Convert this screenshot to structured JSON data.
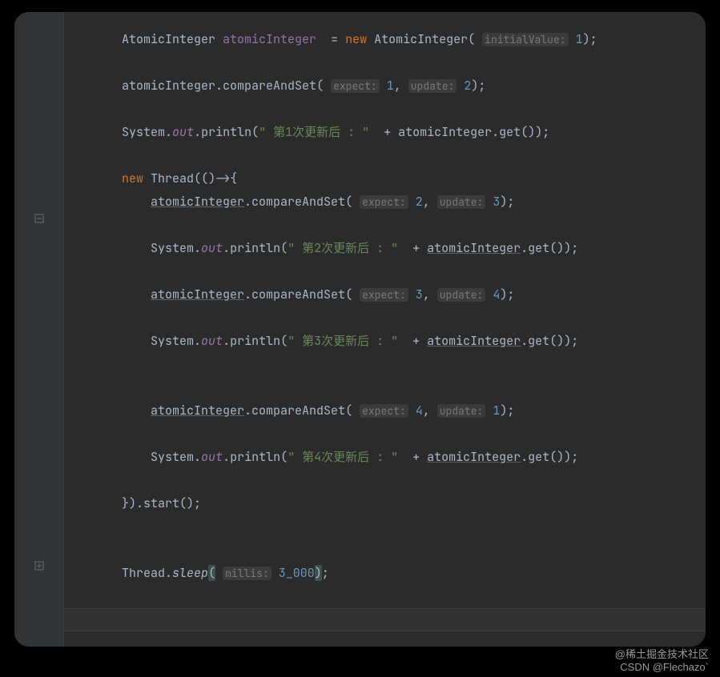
{
  "watermark": {
    "line1": "@稀土掘金技术社区",
    "line2": "CSDN @Flechazo`"
  },
  "code": {
    "indent1": "        ",
    "indent2": "            ",
    "decl": {
      "type": "AtomicInteger",
      "name": "atomicInteger",
      "eq": "  = ",
      "kw_new": "new",
      "ctor": "AtomicInteger",
      "hint": "initialValue:",
      "val": "1"
    },
    "cas1": {
      "obj": "atomicInteger",
      "method": "compareAndSet",
      "h1": "expect:",
      "v1": "1",
      "h2": "update:",
      "v2": "2"
    },
    "p1": {
      "cls": "System",
      "out": "out",
      "m": "println",
      "s": "\" 第1次更新后 : \"",
      "plus": "  + ",
      "obj": "atomicInteger",
      "g": "get"
    },
    "thr": {
      "kw_new": "new",
      "cls": "Thread",
      "arrow": "(()->{ "
    },
    "cas2": {
      "obj": "atomicInteger",
      "method": "compareAndSet",
      "h1": "expect:",
      "v1": "2",
      "h2": "update:",
      "v2": "3"
    },
    "p2": {
      "cls": "System",
      "out": "out",
      "m": "println",
      "s": "\" 第2次更新后 : \"",
      "plus": "  + ",
      "obj": "atomicInteger",
      "g": "get"
    },
    "cas3": {
      "obj": "atomicInteger",
      "method": "compareAndSet",
      "h1": "expect:",
      "v1": "3",
      "h2": "update:",
      "v2": "4"
    },
    "p3": {
      "cls": "System",
      "out": "out",
      "m": "println",
      "s": "\" 第3次更新后 : \"",
      "plus": "  + ",
      "obj": "atomicInteger",
      "g": "get"
    },
    "cas4": {
      "obj": "atomicInteger",
      "method": "compareAndSet",
      "h1": "expect:",
      "v1": "4",
      "h2": "update:",
      "v2": "1"
    },
    "p4": {
      "cls": "System",
      "out": "out",
      "m": "println",
      "s": "\" 第4次更新后 : \"",
      "plus": "  + ",
      "obj": "atomicInteger",
      "g": "get"
    },
    "thr_end": "}).start();",
    "sleep": {
      "cls": "Thread",
      "m": "sleep",
      "hint": "millis:",
      "val": "3_000"
    }
  }
}
